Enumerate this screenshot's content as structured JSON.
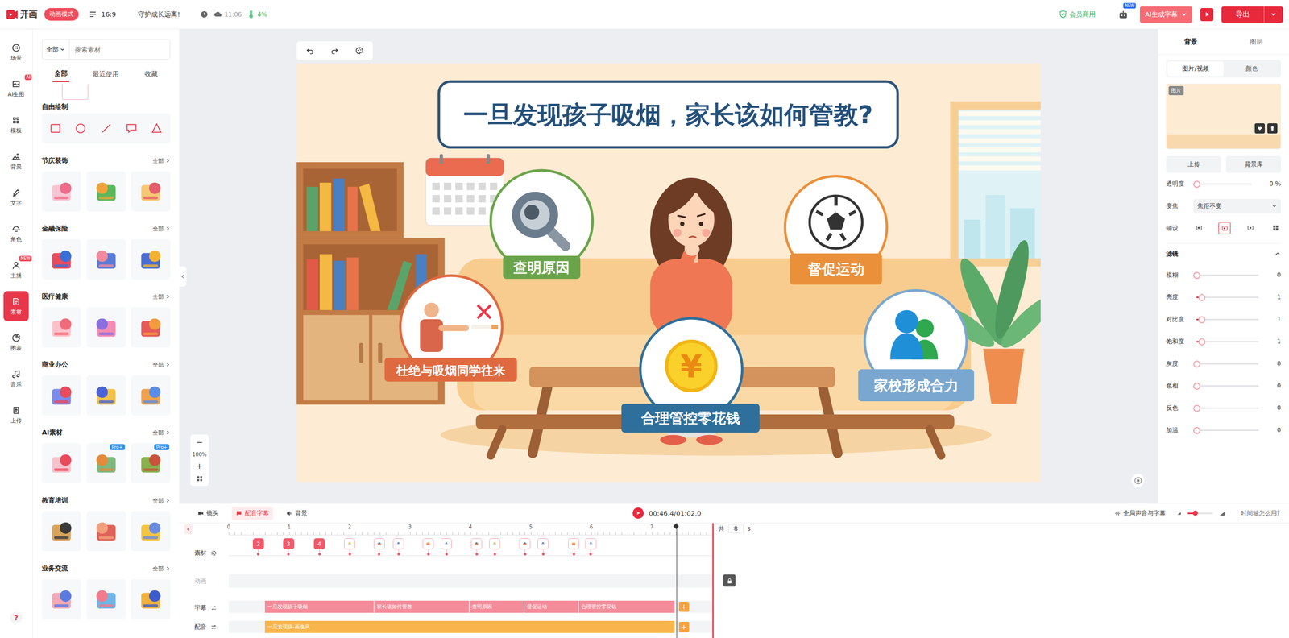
{
  "topbar": {
    "logo": "开画",
    "mode": "动画模式",
    "ratio": "16:9",
    "project": "守护成长远离!",
    "save_time": "11:06",
    "progress": "4%",
    "member": "会员商用",
    "new_badge": "NEW",
    "ai_subtitle": "AI生成字幕",
    "export": "导出"
  },
  "rail": {
    "items": [
      {
        "label": "场景",
        "badge": "",
        "selected": false
      },
      {
        "label": "AI生图",
        "badge": "AI",
        "selected": false
      },
      {
        "label": "模板",
        "badge": "",
        "selected": false
      },
      {
        "label": "背景",
        "badge": "",
        "selected": false
      },
      {
        "label": "文字",
        "badge": "",
        "selected": false
      },
      {
        "label": "角色",
        "badge": "",
        "selected": false
      },
      {
        "label": "主播",
        "badge": "NEW",
        "selected": false
      },
      {
        "label": "素材",
        "badge": "",
        "selected": true
      },
      {
        "label": "图表",
        "badge": "",
        "selected": false
      },
      {
        "label": "音乐",
        "badge": "",
        "selected": false
      },
      {
        "label": "上传",
        "badge": "",
        "selected": false
      }
    ],
    "help": "?"
  },
  "materials": {
    "filter": "全部",
    "search_placeholder": "搜索素材",
    "tabs": [
      {
        "label": "全部",
        "selected": true
      },
      {
        "label": "最近使用",
        "selected": false
      },
      {
        "label": "收藏",
        "selected": false
      }
    ],
    "sections": [
      {
        "title": "自由绘制",
        "more": "",
        "kind": "shapes",
        "items": [
          {
            "badge": ""
          },
          {
            "badge": ""
          },
          {
            "badge": ""
          },
          {
            "badge": ""
          },
          {
            "badge": ""
          }
        ]
      },
      {
        "title": "节庆装饰",
        "more": "全部",
        "kind": "tiles",
        "items": [
          {
            "badge": ""
          },
          {
            "badge": ""
          },
          {
            "badge": ""
          }
        ]
      },
      {
        "title": "金融保险",
        "more": "全部",
        "kind": "tiles",
        "items": [
          {
            "badge": ""
          },
          {
            "badge": ""
          },
          {
            "badge": ""
          }
        ]
      },
      {
        "title": "医疗健康",
        "more": "全部",
        "kind": "tiles",
        "items": [
          {
            "badge": ""
          },
          {
            "badge": ""
          },
          {
            "badge": ""
          }
        ]
      },
      {
        "title": "商业办公",
        "more": "全部",
        "kind": "tiles",
        "items": [
          {
            "badge": ""
          },
          {
            "badge": ""
          },
          {
            "badge": ""
          }
        ]
      },
      {
        "title": "AI素材",
        "more": "全部",
        "kind": "tiles",
        "items": [
          {
            "badge": ""
          },
          {
            "badge": "Pro+"
          },
          {
            "badge": "Pro+"
          }
        ]
      },
      {
        "title": "教育培训",
        "more": "全部",
        "kind": "tiles",
        "items": [
          {
            "badge": ""
          },
          {
            "badge": ""
          },
          {
            "badge": ""
          }
        ]
      },
      {
        "title": "业务交流",
        "more": "全部",
        "kind": "tiles",
        "items": [
          {
            "badge": ""
          },
          {
            "badge": ""
          },
          {
            "badge": ""
          }
        ]
      }
    ]
  },
  "canvas": {
    "title": "一旦发现孩子吸烟，家长该如何管教?",
    "coin_symbol": "¥",
    "bubbles": [
      {
        "label": "查明原因",
        "color": "#6aa44a"
      },
      {
        "label": "督促运动",
        "color": "#ea8f3a"
      },
      {
        "label": "杜绝与吸烟同学往来",
        "color": "#e06a3f"
      },
      {
        "label": "合理管控零花钱",
        "color": "#2f6f9b"
      },
      {
        "label": "家校形成合力",
        "color": "#7aa7cf"
      }
    ]
  },
  "zoom": {
    "minus": "−",
    "value": "100%",
    "plus": "+"
  },
  "right_panel": {
    "tabs": [
      {
        "label": "背景",
        "selected": true
      },
      {
        "label": "图层",
        "selected": false
      }
    ],
    "subtabs": [
      {
        "label": "图片/视频",
        "selected": true
      },
      {
        "label": "颜色",
        "selected": false
      }
    ],
    "preview_label": "图片",
    "buttons": [
      "上传",
      "背景库"
    ],
    "opacity": {
      "label": "透明度",
      "value": "0",
      "unit": "%",
      "level": 0
    },
    "zoom": {
      "label": "变焦",
      "value": "焦距不变"
    },
    "tile": {
      "label": "铺设",
      "options": [
        {
          "selected": false
        },
        {
          "selected": true
        },
        {
          "selected": false
        },
        {
          "selected": false
        }
      ]
    },
    "filters": {
      "title": "滤镜",
      "expanded": true,
      "items": [
        {
          "label": "模糊",
          "value": "0",
          "level": 0
        },
        {
          "label": "亮度",
          "value": "1",
          "level": 0.08
        },
        {
          "label": "对比度",
          "value": "1",
          "level": 0.08
        },
        {
          "label": "饱和度",
          "value": "1",
          "level": 0.08
        },
        {
          "label": "灰度",
          "value": "0",
          "level": 0
        },
        {
          "label": "色相",
          "value": "0",
          "level": 0
        },
        {
          "label": "反色",
          "value": "0",
          "level": 0
        },
        {
          "label": "加温",
          "value": "0",
          "level": 0
        }
      ]
    }
  },
  "timeline": {
    "tabs": [
      {
        "label": "镜头",
        "selected": false
      },
      {
        "label": "配音字幕",
        "selected": true
      },
      {
        "label": "背景",
        "selected": false
      }
    ],
    "time": "00:46.4/01:02.0",
    "global": "全局声音与字幕",
    "volume": {
      "level": 0.3
    },
    "help": "时间轴怎么用?",
    "ruler": [
      "0",
      "1",
      "2",
      "3",
      "4",
      "5",
      "6",
      "7"
    ],
    "total": {
      "prefix": "共",
      "value": "8",
      "unit": "s"
    },
    "playhead": 7.41,
    "tracks": {
      "material": "素材",
      "animation": "动画",
      "subtitle": "字幕",
      "voice": "配音"
    },
    "markers": [
      {
        "kind": "number",
        "text": "2",
        "time": 0.49
      },
      {
        "kind": "number",
        "text": "3",
        "time": 0.99
      },
      {
        "kind": "number",
        "text": "4",
        "time": 1.5
      },
      {
        "kind": "thumb",
        "text": "",
        "time": 2.0
      },
      {
        "kind": "thumb",
        "text": "",
        "time": 2.49
      },
      {
        "kind": "thumb",
        "text": "",
        "time": 2.81
      },
      {
        "kind": "thumb",
        "text": "",
        "time": 3.3
      },
      {
        "kind": "thumb",
        "text": "",
        "time": 3.6
      },
      {
        "kind": "thumb",
        "text": "",
        "time": 4.1
      },
      {
        "kind": "thumb",
        "text": "",
        "time": 4.4
      },
      {
        "kind": "thumb",
        "text": "",
        "time": 4.9
      },
      {
        "kind": "thumb",
        "text": "",
        "time": 5.2
      },
      {
        "kind": "thumb",
        "text": "",
        "time": 5.71
      },
      {
        "kind": "thumb",
        "text": "",
        "time": 5.99
      }
    ],
    "subtitles": [
      {
        "text": "一旦发现孩子吸烟",
        "start": 0.6,
        "end": 2.41
      },
      {
        "text": "家长该如何管教",
        "start": 2.41,
        "end": 3.98
      },
      {
        "text": "查明原因",
        "start": 3.98,
        "end": 4.89
      },
      {
        "text": "督促运动",
        "start": 4.89,
        "end": 5.79
      },
      {
        "text": "合理管控零花钱",
        "start": 5.79,
        "end": 7.38
      }
    ],
    "voice": [
      {
        "text": "一旦发现孩-画逸风",
        "start": 0.6,
        "end": 7.38
      }
    ],
    "add": "+"
  }
}
